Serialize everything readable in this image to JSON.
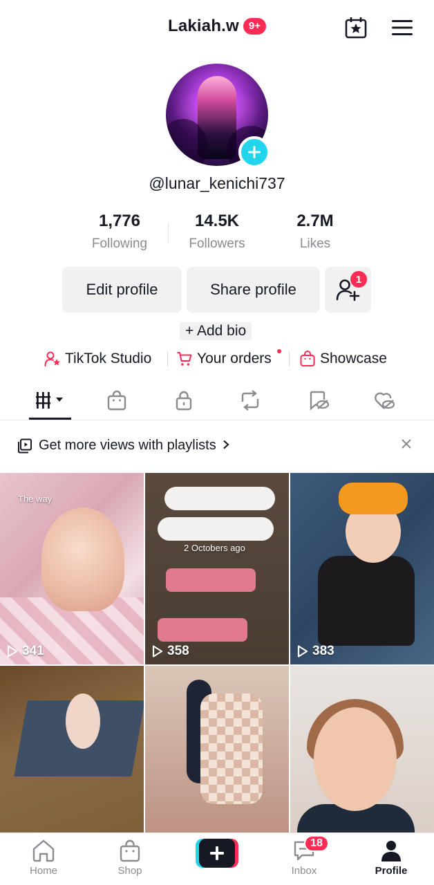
{
  "header": {
    "title": "Lakiah.w",
    "badge": "9+",
    "icons": [
      "calendar-star-icon",
      "menu-icon"
    ]
  },
  "profile": {
    "username": "@lunar_kenichi737"
  },
  "stats": [
    {
      "value": "1,776",
      "label": "Following"
    },
    {
      "value": "14.5K",
      "label": "Followers"
    },
    {
      "value": "2.7M",
      "label": "Likes"
    }
  ],
  "actions": {
    "edit_profile": "Edit profile",
    "share_profile": "Share profile",
    "friends_badge": "1"
  },
  "bio": {
    "add_bio": "+ Add bio"
  },
  "quick_links": [
    {
      "label": "TikTok Studio",
      "icon": "person-star-icon"
    },
    {
      "label": "Your orders",
      "icon": "cart-icon"
    },
    {
      "label": "Showcase",
      "icon": "shopping-bag-icon"
    }
  ],
  "tabs": [
    "videos-grid-icon",
    "shop-bag-icon",
    "lock-icon",
    "repost-icon",
    "favorites-hidden-icon",
    "liked-hidden-icon"
  ],
  "banner": {
    "text": "Get more views with playlists",
    "icon": "playlist-icon"
  },
  "videos": [
    {
      "views": "341",
      "overlay": "The way"
    },
    {
      "views": "358",
      "overlay": "2 Octobers ago"
    },
    {
      "views": "383",
      "overlay": ""
    },
    {
      "views": "",
      "overlay": ""
    },
    {
      "views": "",
      "overlay": ""
    },
    {
      "views": "",
      "overlay": ""
    }
  ],
  "nav": {
    "home": "Home",
    "shop": "Shop",
    "inbox": "Inbox",
    "inbox_badge": "18",
    "profile": "Profile"
  },
  "colors": {
    "accent": "#fe2c55",
    "teal": "#20d5ec",
    "text": "#161823",
    "muted": "#8a8b91"
  }
}
